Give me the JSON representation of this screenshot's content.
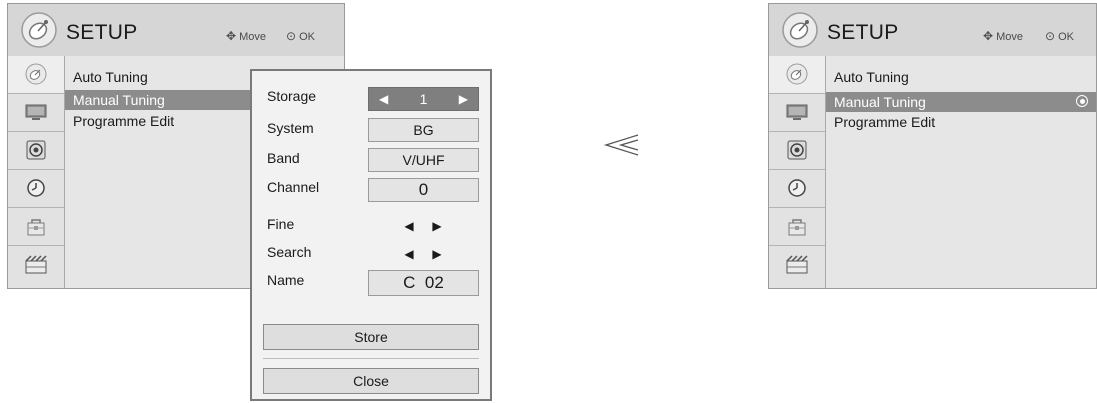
{
  "left_menu": {
    "title": "SETUP",
    "hint_move": "Move",
    "hint_ok": "OK",
    "sidebar_icons": [
      "satellite-icon",
      "picture-icon",
      "speaker-icon",
      "clock-icon",
      "lock-icon",
      "input-icon"
    ],
    "items": [
      {
        "label": "Auto Tuning"
      },
      {
        "label": "Manual Tuning"
      },
      {
        "label": "Programme Edit"
      }
    ]
  },
  "popup": {
    "rows": {
      "storage": {
        "label": "Storage",
        "value": "1"
      },
      "system": {
        "label": "System",
        "value": "BG"
      },
      "band": {
        "label": "Band",
        "value": "V/UHF"
      },
      "channel": {
        "label": "Channel",
        "value": "0"
      },
      "fine": {
        "label": "Fine"
      },
      "search": {
        "label": "Search"
      },
      "name": {
        "label": "Name",
        "value": "C  02"
      }
    },
    "store_label": "Store",
    "close_label": "Close"
  },
  "right_menu": {
    "title": "SETUP",
    "hint_move": "Move",
    "hint_ok": "OK",
    "items": [
      {
        "label": "Auto Tuning"
      },
      {
        "label": "Manual Tuning"
      },
      {
        "label": "Programme Edit"
      }
    ]
  },
  "colors": {
    "selection": "#8c8c8c",
    "storage_field": "#7f7f7f",
    "header": "#d6d6d6"
  }
}
